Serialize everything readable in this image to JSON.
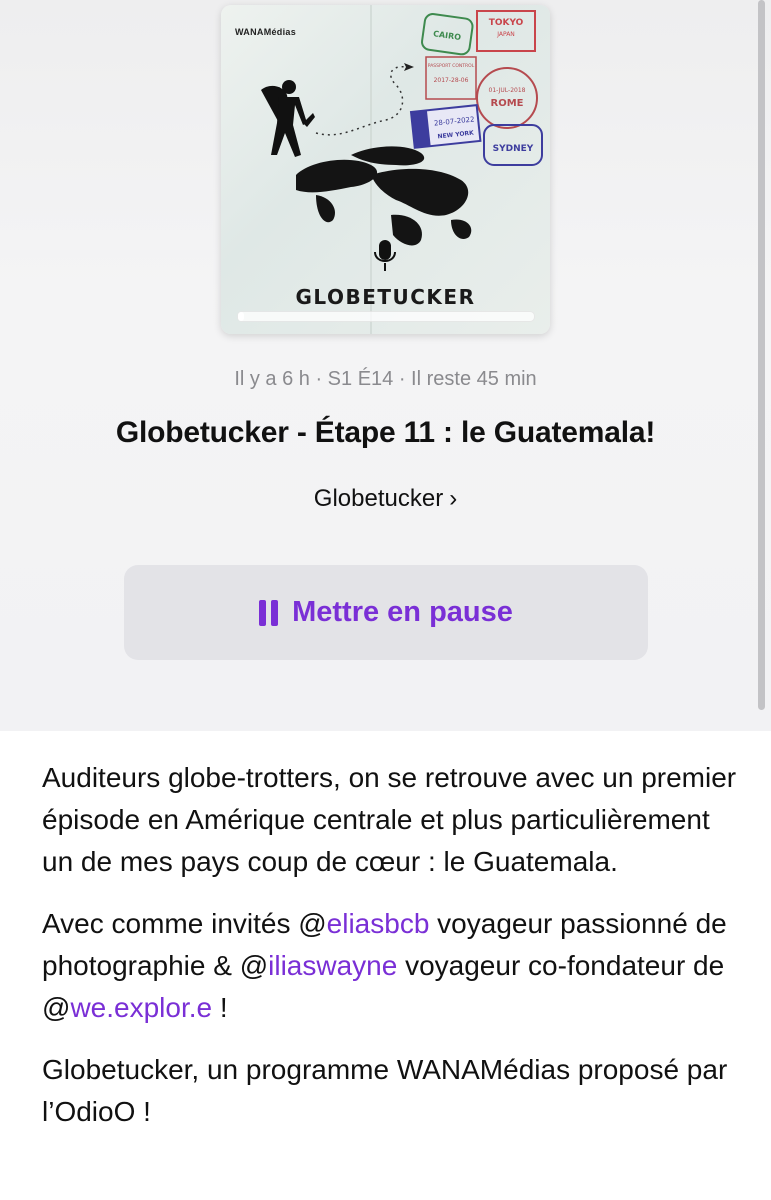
{
  "artwork": {
    "brand": "WANAMédias",
    "title": "GLOBETUCKER",
    "stamps": {
      "cairo": "CAIRO",
      "tokyo": "TOKYO",
      "tokyo_sub": "JAPAN",
      "passport": "PASSPORT CONTROL",
      "passport_date": "2017-28-06",
      "rome": "ROME",
      "rome_date": "01-JUL-2018",
      "newyork": "NEW YORK",
      "newyork_date": "28-07-2022",
      "sydney": "SYDNEY"
    },
    "progress": 0.02
  },
  "episode": {
    "meta": "Il y a 6 h · S1 É14 · Il reste 45 min",
    "title": "Globetucker - Étape 11 : le Guatemala!",
    "show": "Globetucker",
    "show_chevron": "›",
    "pause_label": "Mettre en pause"
  },
  "description": {
    "p1": "Auditeurs globe-trotters, on se retrouve avec un premier épisode en Amérique centrale et plus particulièrement un de mes pays coup de cœur : le Guatemala.",
    "p2_a": "Avec comme invités @",
    "p2_m1": "eliasbcb",
    "p2_b": " voyageur passionné de photographie & @",
    "p2_m2": "iliaswayne",
    "p2_c": " voyageur co-fondateur de @",
    "p2_m3": "we.explor.e",
    "p2_d": " !",
    "p3": "Globetucker, un programme WANAMédias proposé par l’OdioO !"
  },
  "colors": {
    "accent": "#7a2fd6",
    "header_bg": "#f2f2f4",
    "button_bg": "#e3e3e7",
    "meta_text": "#8a8a8e"
  }
}
